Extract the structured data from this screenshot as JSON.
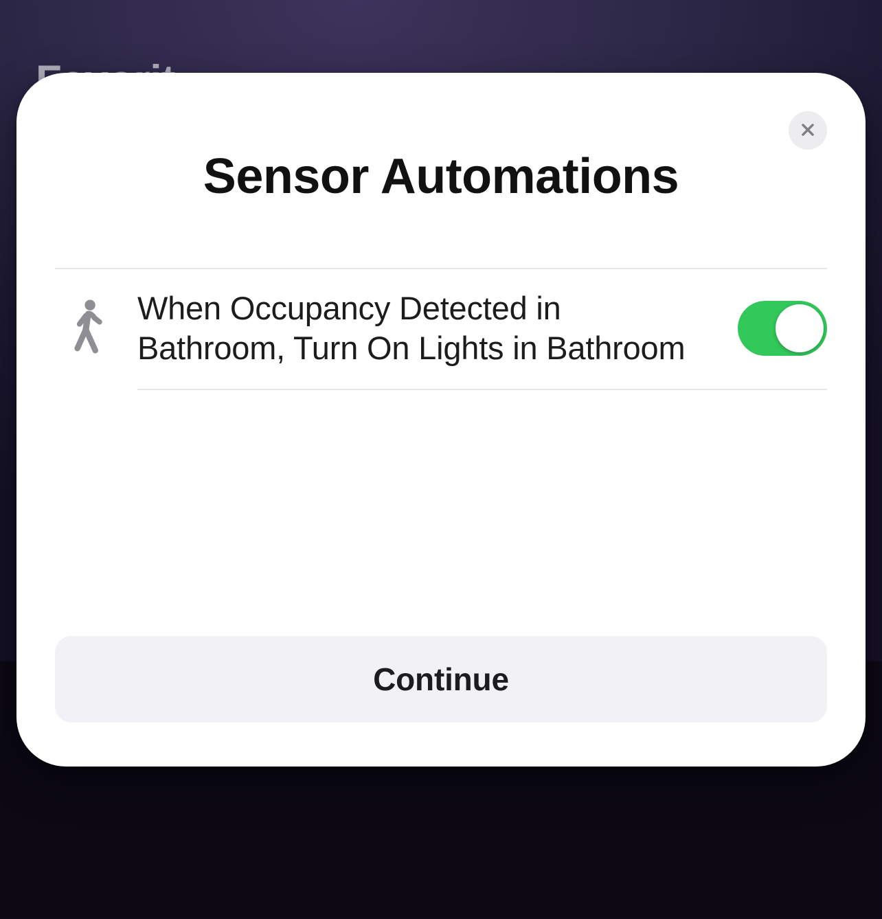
{
  "background": {
    "partial_title": "Favorit"
  },
  "sheet": {
    "title": "Sensor Automations",
    "rows": [
      {
        "icon": "walking-person",
        "label": "When Occupancy Detected in Bathroom, Turn On Lights in Bathroom",
        "on": true
      }
    ],
    "continue_label": "Continue"
  }
}
